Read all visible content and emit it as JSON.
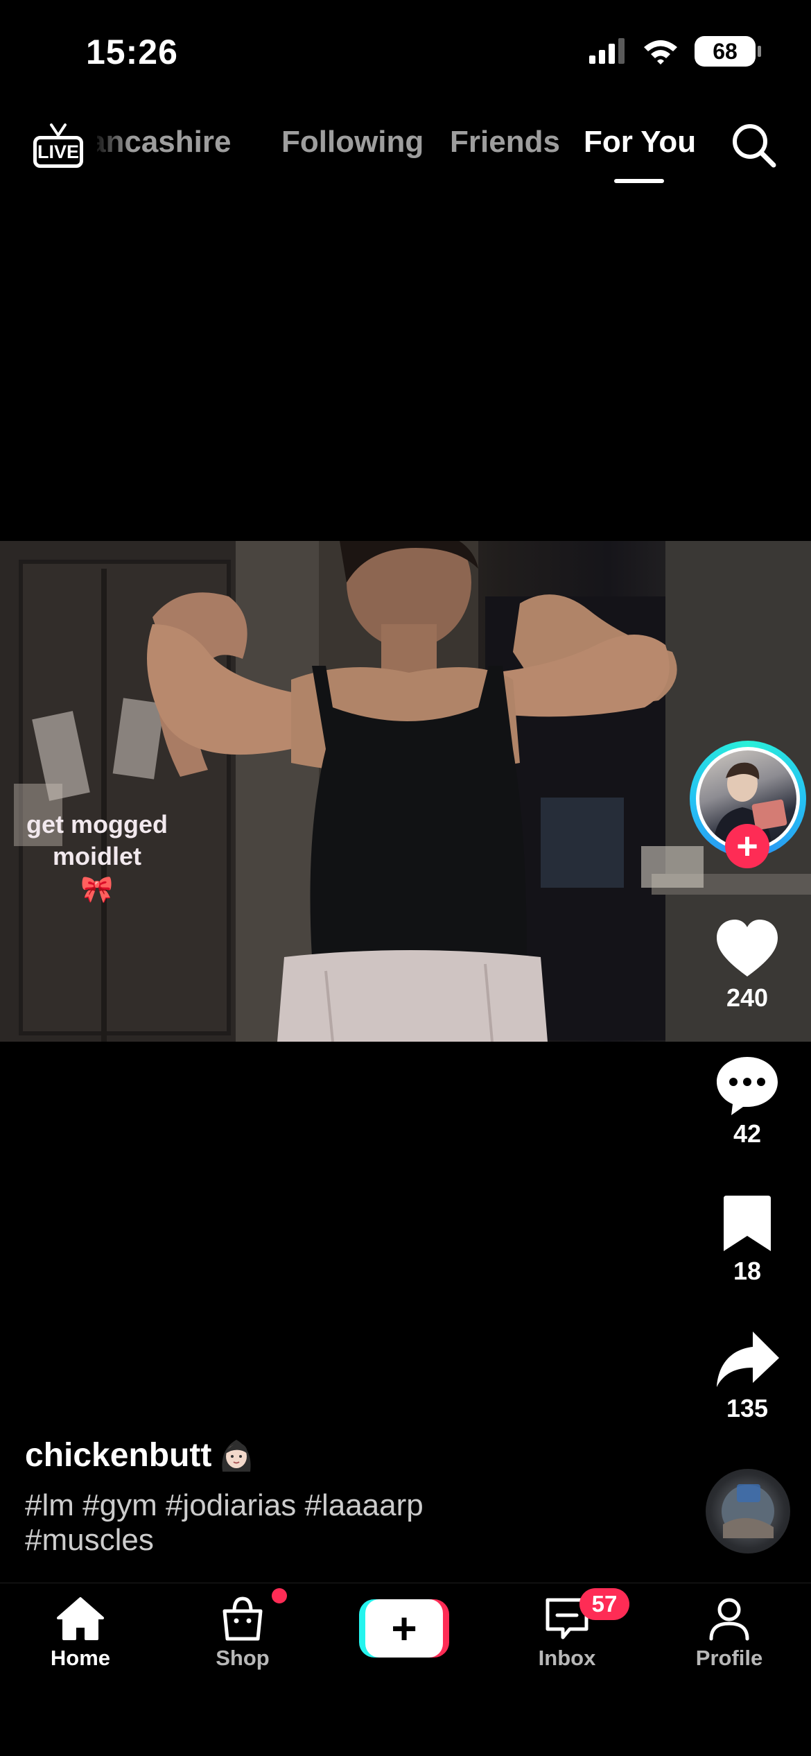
{
  "status_bar": {
    "time": "15:26",
    "battery": "68",
    "icons": [
      "cellular-signal-icon",
      "wifi-icon",
      "battery-icon"
    ]
  },
  "top_nav": {
    "live_label": "LIVE",
    "tabs": [
      {
        "label": "ancashire",
        "active": false
      },
      {
        "label": "Following",
        "active": false
      },
      {
        "label": "Friends",
        "active": false
      },
      {
        "label": "For You",
        "active": true
      }
    ],
    "search_icon": "search-icon"
  },
  "video": {
    "overlay_text": "get mogged moidlet",
    "overlay_emoji": "🎀"
  },
  "actions": {
    "likes": "240",
    "comments": "42",
    "saves": "18",
    "shares": "135"
  },
  "post": {
    "username": "chickenbutt",
    "hashtags": "#lm #gym #jodiarias #laaaarp #muscles"
  },
  "bottom_nav": {
    "items": [
      {
        "label": "Home",
        "icon": "home-icon",
        "active": true
      },
      {
        "label": "Shop",
        "icon": "shopping-bag-icon",
        "active": false
      },
      {
        "label": "Inbox",
        "icon": "inbox-icon",
        "active": false
      },
      {
        "label": "Profile",
        "icon": "profile-icon",
        "active": false
      }
    ],
    "inbox_badge": "57"
  },
  "colors": {
    "accent_red": "#fe2c55",
    "accent_cyan": "#25f4ee",
    "background": "#000000"
  }
}
